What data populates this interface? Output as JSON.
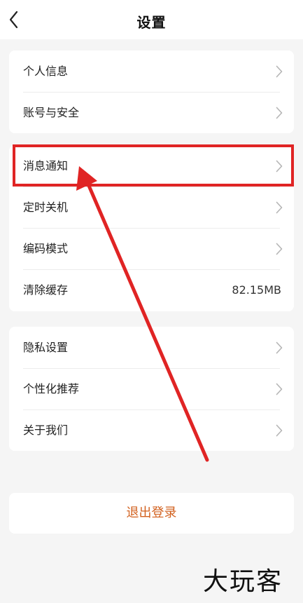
{
  "header": {
    "title": "设置",
    "back_icon": "chevron-left-icon"
  },
  "groups": [
    {
      "items": [
        {
          "label": "个人信息",
          "chevron": true
        },
        {
          "label": "账号与安全",
          "chevron": true
        }
      ]
    },
    {
      "items": [
        {
          "label": "消息通知",
          "chevron": true,
          "highlighted": true
        },
        {
          "label": "定时关机",
          "chevron": true
        },
        {
          "label": "编码模式",
          "chevron": true
        },
        {
          "label": "清除缓存",
          "value": "82.15MB"
        }
      ]
    },
    {
      "items": [
        {
          "label": "隐私设置",
          "chevron": true
        },
        {
          "label": "个性化推荐",
          "chevron": true
        },
        {
          "label": "关于我们",
          "chevron": true
        }
      ]
    }
  ],
  "logout": {
    "label": "退出登录"
  },
  "watermark": {
    "text": "大玩客"
  },
  "colors": {
    "background": "#f5f5f5",
    "card": "#ffffff",
    "logout_text": "#d2611f",
    "annotation_red": "#e02424"
  }
}
